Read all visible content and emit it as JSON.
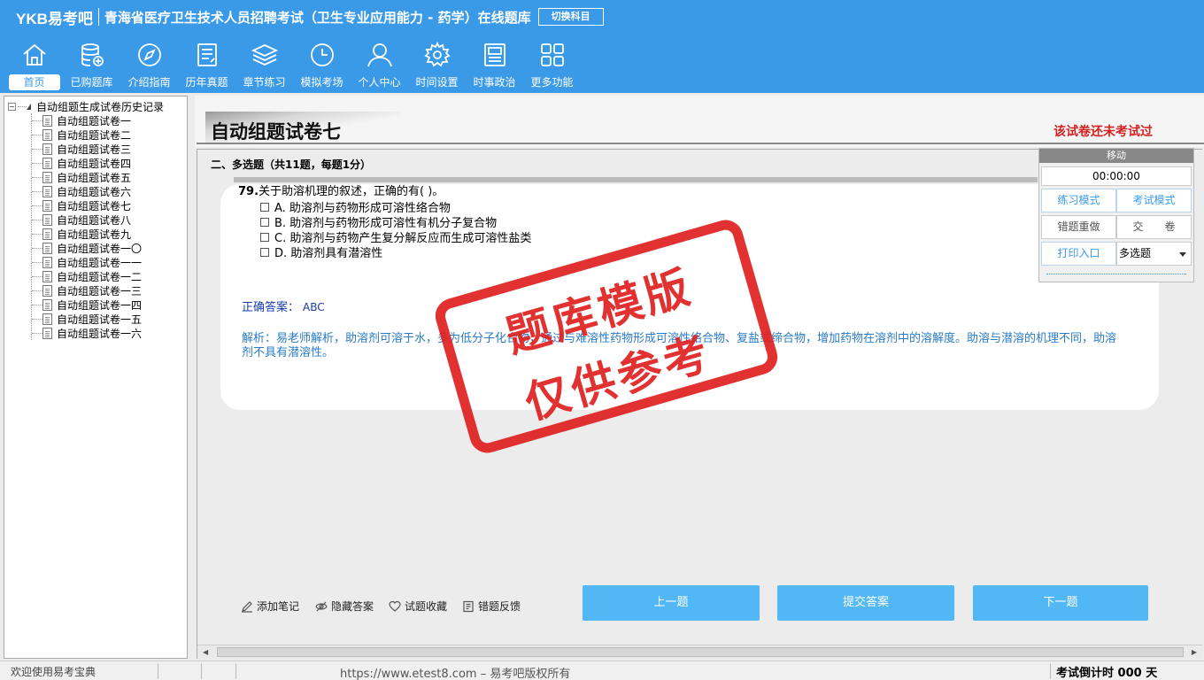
{
  "header": {
    "brand": "YKB易考吧",
    "title": "青海省医疗卫生技术人员招聘考试（卫生专业应用能力 - 药学）在线题库",
    "switch_label": "切换科目",
    "nav": [
      {
        "label": "首页",
        "icon": "home-icon",
        "active": true
      },
      {
        "label": "已购题库",
        "icon": "database-icon"
      },
      {
        "label": "介绍指南",
        "icon": "compass-icon"
      },
      {
        "label": "历年真题",
        "icon": "list-icon"
      },
      {
        "label": "章节练习",
        "icon": "layers-icon"
      },
      {
        "label": "模拟考场",
        "icon": "clock-icon"
      },
      {
        "label": "个人中心",
        "icon": "user-icon"
      },
      {
        "label": "时间设置",
        "icon": "gear-icon"
      },
      {
        "label": "时事政治",
        "icon": "news-icon"
      },
      {
        "label": "更多功能",
        "icon": "grid-icon"
      }
    ]
  },
  "tree": {
    "root": "自动组题生成试卷历史记录",
    "items": [
      "自动组题试卷一",
      "自动组题试卷二",
      "自动组题试卷三",
      "自动组题试卷四",
      "自动组题试卷五",
      "自动组题试卷六",
      "自动组题试卷七",
      "自动组题试卷八",
      "自动组题试卷九",
      "自动组题试卷一〇",
      "自动组题试卷一一",
      "自动组题试卷一二",
      "自动组题试卷一三",
      "自动组题试卷一四",
      "自动组题试卷一五",
      "自动组题试卷一六"
    ]
  },
  "paper": {
    "title": "自动组题试卷七",
    "status": "该试卷还未考试过"
  },
  "section": {
    "header": "二、多选题（共11题，每题1分）"
  },
  "question": {
    "number": "79.",
    "text": "关于助溶机理的叙述，正确的有(  )。",
    "options": [
      "A. 助溶剂与药物形成可溶性络合物",
      "B. 助溶剂与药物形成可溶性有机分子复合物",
      "C. 助溶剂与药物产生复分解反应而生成可溶性盐类",
      "D. 助溶剂具有潜溶性"
    ],
    "answer_label": "正确答案：",
    "answer_value": "ABC",
    "analysis": "解析：易老师解析，助溶剂可溶于水，多为低分子化合物，通过与难溶性药物形成可溶性络合物、复盐或缔合物，增加药物在溶剂中的溶解度。助溶与潜溶的机理不同，助溶剂不具有潜溶性。"
  },
  "tools": {
    "move": "移动",
    "timer": "00:00:00",
    "practice_mode": "练习模式",
    "exam_mode": "考试模式",
    "redo_wrong": "错题重做",
    "submit_paper": "交　　卷",
    "print": "打印入口",
    "type_select": "多选题"
  },
  "actions": {
    "add_note": "添加笔记",
    "hide_answer": "隐藏答案",
    "favorite": "试题收藏",
    "feedback": "错题反馈",
    "prev": "上一题",
    "submit": "提交答案",
    "next": "下一题"
  },
  "statusbar": {
    "welcome": "欢迎使用易考宝典",
    "copyright": "https://www.etest8.com – 易考吧版权所有",
    "countdown": "考试倒计时 000 天"
  },
  "stamp": {
    "line1": "题库模版",
    "line2": "仅供参考"
  },
  "colors": {
    "header_bg": "#3a9ae8",
    "primary_button": "#52b8f5",
    "status_red": "#d42020",
    "analysis_blue": "#2a7bc4"
  }
}
